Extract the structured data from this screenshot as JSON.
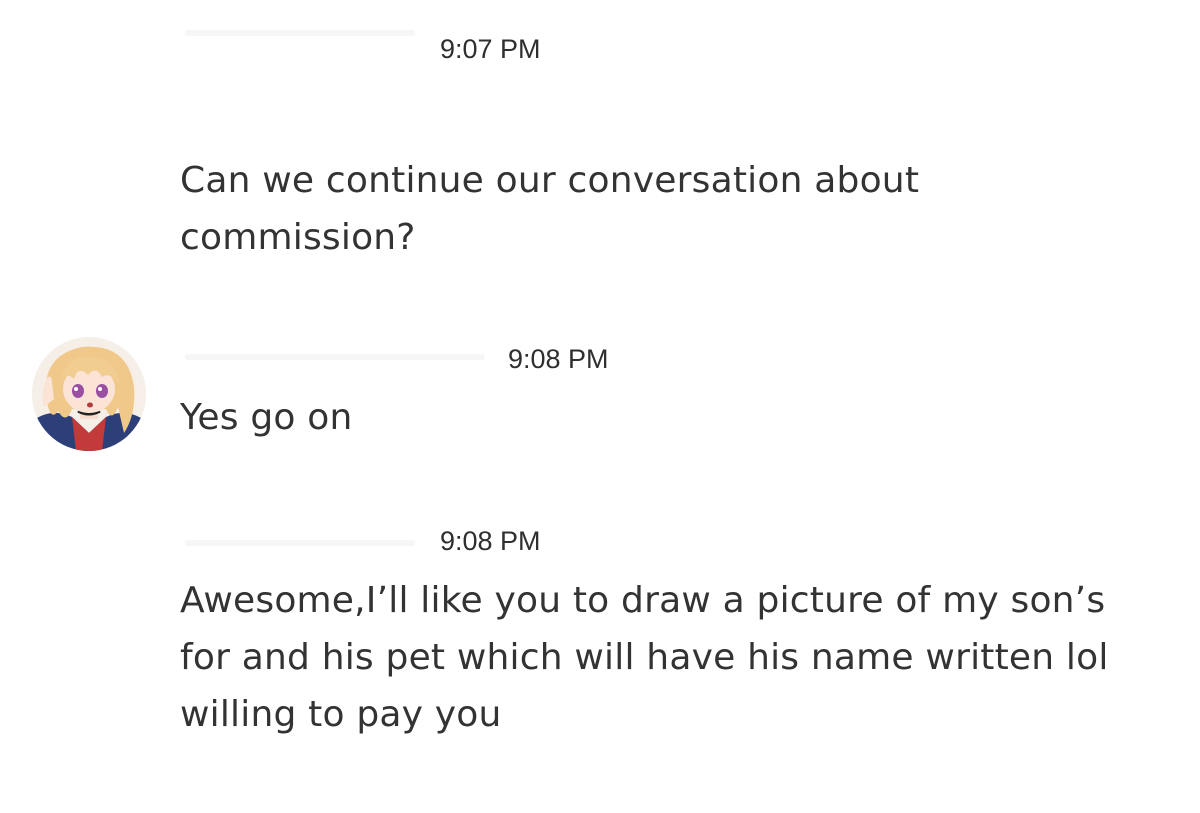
{
  "messages": [
    {
      "time": "9:07 PM",
      "text": "Can we continue our conversation about commission?"
    },
    {
      "time": "9:08 PM",
      "text": "Yes go on",
      "avatar": "anime-girl-avatar"
    },
    {
      "time": "9:08 PM",
      "text": "Awesome,I’ll like you to draw a picture of my son’s for and his pet which will have his name written lol willing to pay you"
    }
  ],
  "colors": {
    "text": "#333333",
    "background": "#ffffff",
    "avatar_hair": "#f0c98a",
    "avatar_ring": "#c23a3a"
  }
}
